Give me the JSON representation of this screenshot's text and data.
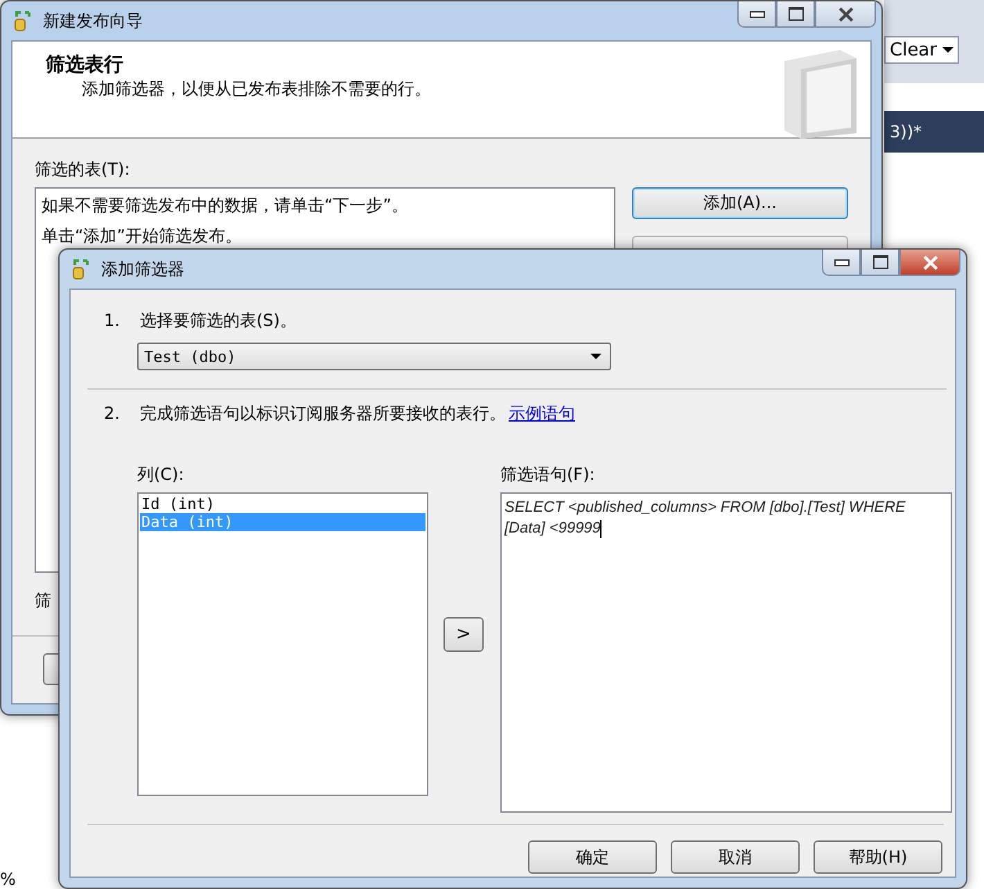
{
  "background_app": {
    "toolbar_dropdown": "Clear",
    "document_tab": "3))*",
    "zoom_value": "%"
  },
  "wizard": {
    "title": "新建发布向导",
    "heading": "筛选表行",
    "subtitle": "添加筛选器，以便从已发布表排除不需要的行。",
    "tables_label": "筛选的表(T):",
    "tables_list": [
      "如果不需要筛选发布中的数据，请单击“下一步”。",
      "单击“添加”开始筛选发布。"
    ],
    "buttons": [
      {
        "label": "添加(A)...",
        "disabled": false
      },
      {
        "disabled": true
      }
    ],
    "filter_label": "筛"
  },
  "dialog": {
    "title": "添加筛选器",
    "step1": {
      "number": "1.",
      "text": "选择要筛选的表(S)。",
      "table_value": "Test (dbo)"
    },
    "step2": {
      "number": "2.",
      "text": "完成筛选语句以标识订阅服务器所要接收的表行。",
      "link": "示例语句"
    },
    "columns_label": "列(C):",
    "columns": [
      {
        "label": "Id (int)",
        "selected": false
      },
      {
        "label": "Data (int)",
        "selected": true
      }
    ],
    "add_button": ">",
    "statement_label": "筛选语句(F):",
    "statement": "SELECT <published_columns> FROM [dbo].[Test] WHERE\n[Data] <99999",
    "buttons": [
      "确定",
      "取消",
      "帮助(H)"
    ]
  }
}
